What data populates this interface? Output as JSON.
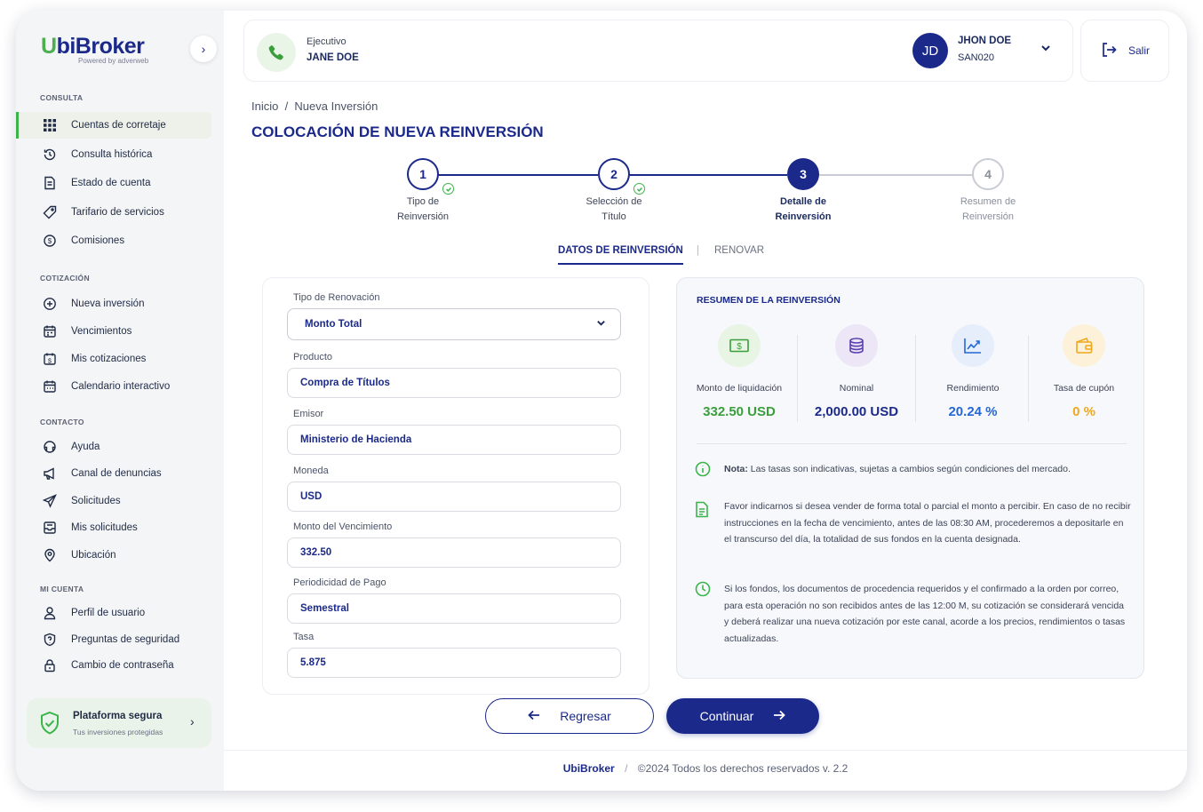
{
  "brand": {
    "name_first": "U",
    "name_rest": "biBroker",
    "tagline": "Powered by adverweb"
  },
  "sidebar": {
    "sections": [
      {
        "title": "CONSULTA",
        "items": [
          {
            "label": "Cuentas de corretaje",
            "icon": "grid-icon",
            "active": true
          },
          {
            "label": "Consulta histórica",
            "icon": "history-icon"
          },
          {
            "label": "Estado de cuenta",
            "icon": "document-icon"
          },
          {
            "label": "Tarifario de servicios",
            "icon": "tag-icon"
          },
          {
            "label": "Comisiones",
            "icon": "dollar-cycle-icon"
          }
        ]
      },
      {
        "title": "COTIZACIÓN",
        "items": [
          {
            "label": "Nueva inversión",
            "icon": "plus-circle-icon"
          },
          {
            "label": "Vencimientos",
            "icon": "calendar-icon"
          },
          {
            "label": "Mis cotizaciones",
            "icon": "calendar-dollar-icon"
          },
          {
            "label": "Calendario interactivo",
            "icon": "calendar-grid-icon"
          }
        ]
      },
      {
        "title": "CONTACTO",
        "items": [
          {
            "label": "Ayuda",
            "icon": "help-icon"
          },
          {
            "label": "Canal de denuncias",
            "icon": "megaphone-icon"
          },
          {
            "label": "Solicitudes",
            "icon": "send-icon"
          },
          {
            "label": "Mis solicitudes",
            "icon": "inbox-icon"
          },
          {
            "label": "Ubicación",
            "icon": "location-icon"
          }
        ]
      },
      {
        "title": "MI CUENTA",
        "items": [
          {
            "label": "Perfil de usuario",
            "icon": "user-icon"
          },
          {
            "label": "Preguntas de seguridad",
            "icon": "shield-question-icon"
          },
          {
            "label": "Cambio de contraseña",
            "icon": "lock-icon"
          }
        ]
      }
    ],
    "secure": {
      "title": "Plataforma segura",
      "subtitle": "Tus inversiones protegidas"
    }
  },
  "header": {
    "executive_label": "Ejecutivo",
    "executive_name": "JANE DOE",
    "user_initials": "JD",
    "user_name": "JHON DOE",
    "user_code": "SAN020",
    "logout_label": "Salir"
  },
  "breadcrumb": "Inicio  /  Nueva Inversión",
  "page_title": "COLOCACIÓN DE NUEVA REINVERSIÓN",
  "stepper": [
    {
      "number": "1",
      "line1": "Tipo de",
      "line2": "Reinversión",
      "state": "done"
    },
    {
      "number": "2",
      "line1": "Selección de",
      "line2": "Título",
      "state": "done"
    },
    {
      "number": "3",
      "line1": "Detalle de",
      "line2": "Reinversión",
      "state": "current"
    },
    {
      "number": "4",
      "line1": "Resumen de",
      "line2": "Reinversión",
      "state": "pending"
    }
  ],
  "tabs": {
    "active": "DATOS DE REINVERSIÓN",
    "separator": "|",
    "inactive": "RENOVAR"
  },
  "form": {
    "renewal_type": {
      "label": "Tipo de Renovación",
      "value": "Monto Total"
    },
    "product": {
      "label": "Producto",
      "value": "Compra de Títulos"
    },
    "issuer": {
      "label": "Emisor",
      "value": "Ministerio de Hacienda"
    },
    "currency": {
      "label": "Moneda",
      "value": "USD"
    },
    "maturity_amount": {
      "label": "Monto del Vencimiento",
      "value": "332.50"
    },
    "payment_frequency": {
      "label": "Periodicidad de Pago",
      "value": "Semestral"
    },
    "rate": {
      "label": "Tasa",
      "value": "5.875"
    }
  },
  "summary": {
    "title": "RESUMEN DE LA REINVERSIÓN",
    "metrics": [
      {
        "label": "Monto de liquidación",
        "value": "332.50 USD",
        "color": "#3a9e3a",
        "bg": "#e8f5e4",
        "icon": "cash-icon"
      },
      {
        "label": "Nominal",
        "value": "2,000.00 USD",
        "color": "#1b2a8a",
        "bg": "#ece6f7",
        "icon": "coins-stack-icon"
      },
      {
        "label": "Rendimiento",
        "value": "20.24 %",
        "color": "#2467d6",
        "bg": "#e6eefb",
        "icon": "trend-chart-icon"
      },
      {
        "label": "Tasa de cupón",
        "value": "0 %",
        "color": "#f0a81c",
        "bg": "#fdf1d9",
        "icon": "wallet-icon"
      }
    ],
    "note_bold": "Nota:",
    "note_text": " Las tasas son indicativas, sujetas a cambios según condiciones del mercado.",
    "info_text": "Favor indicarnos si desea vender de forma total o parcial el monto a percibir. En caso de no recibir instrucciones en la fecha de vencimiento, antes de las 08:30 AM, procederemos a depositarle en el transcurso del día, la totalidad de sus fondos en la cuenta designada.",
    "clock_text": "Si los fondos, los documentos de procedencia requeridos y el confirmado a la orden por correo, para esta operación no son recibidos antes de las 12:00 M, su cotización se considerará vencida y deberá realizar una nueva cotización por este canal, acorde a los precios, rendimientos o tasas actualizadas."
  },
  "actions": {
    "back": "Regresar",
    "next": "Continuar"
  },
  "footer": {
    "brand": "UbiBroker",
    "separator": "/",
    "text": "©2024 Todos los derechos reservados v. 2.2"
  },
  "colors": {
    "primary": "#1b2a8a",
    "accent_green": "#3bb54a"
  }
}
